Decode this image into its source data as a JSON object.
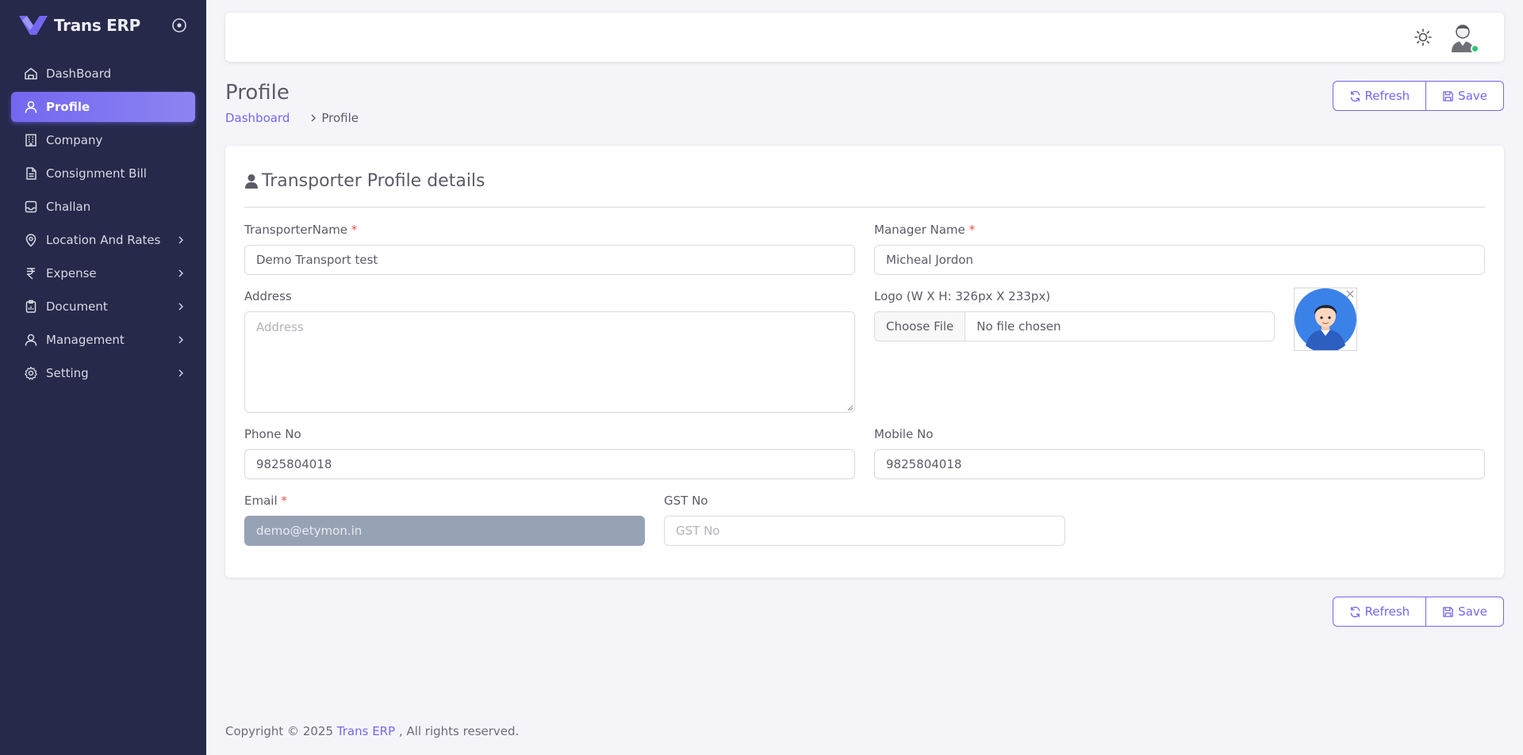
{
  "app": {
    "name": "Trans ERP"
  },
  "sidebar": {
    "items": [
      {
        "label": "DashBoard",
        "icon": "home-icon",
        "has_children": false,
        "active": false
      },
      {
        "label": "Profile",
        "icon": "user-icon",
        "has_children": false,
        "active": true
      },
      {
        "label": "Company",
        "icon": "building-icon",
        "has_children": false,
        "active": false
      },
      {
        "label": "Consignment Bill",
        "icon": "file-text-icon",
        "has_children": false,
        "active": false
      },
      {
        "label": "Challan",
        "icon": "inbox-icon",
        "has_children": false,
        "active": false
      },
      {
        "label": "Location And Rates",
        "icon": "map-pin-icon",
        "has_children": true,
        "active": false
      },
      {
        "label": "Expense",
        "icon": "rupee-icon",
        "has_children": true,
        "active": false
      },
      {
        "label": "Document",
        "icon": "clipboard-icon",
        "has_children": true,
        "active": false
      },
      {
        "label": "Management",
        "icon": "user-icon",
        "has_children": true,
        "active": false
      },
      {
        "label": "Setting",
        "icon": "gear-icon",
        "has_children": true,
        "active": false
      }
    ]
  },
  "page": {
    "title": "Profile",
    "breadcrumb": {
      "home": "Dashboard",
      "current": "Profile"
    },
    "actions": {
      "refresh": "Refresh",
      "save": "Save"
    }
  },
  "form": {
    "title": "Transporter Profile details",
    "transporter_name": {
      "label": "TransporterName",
      "required_mark": "*",
      "value": "Demo Transport test"
    },
    "manager_name": {
      "label": "Manager Name",
      "required_mark": "*",
      "value": "Micheal Jordon"
    },
    "address": {
      "label": "Address",
      "placeholder": "Address",
      "value": ""
    },
    "logo": {
      "label": "Logo (W X H: 326px X 233px)",
      "button": "Choose File",
      "status": "No file chosen"
    },
    "phone": {
      "label": "Phone No",
      "value": "9825804018"
    },
    "mobile": {
      "label": "Mobile No",
      "value": "9825804018"
    },
    "email": {
      "label": "Email",
      "required_mark": "*",
      "value": "demo@etymon.in",
      "disabled": true
    },
    "gst": {
      "label": "GST No",
      "placeholder": "GST No",
      "value": ""
    }
  },
  "footer": {
    "prefix": "Copyright © 2025 ",
    "brand": "Trans ERP",
    "suffix": " , All rights reserved."
  },
  "colors": {
    "sidebar_bg": "#26294a",
    "primary": "#7367f0",
    "page_bg": "#f5f5f9",
    "required": "#ea5455",
    "online": "#28c76f",
    "disabled_input": "#97a2b5"
  }
}
